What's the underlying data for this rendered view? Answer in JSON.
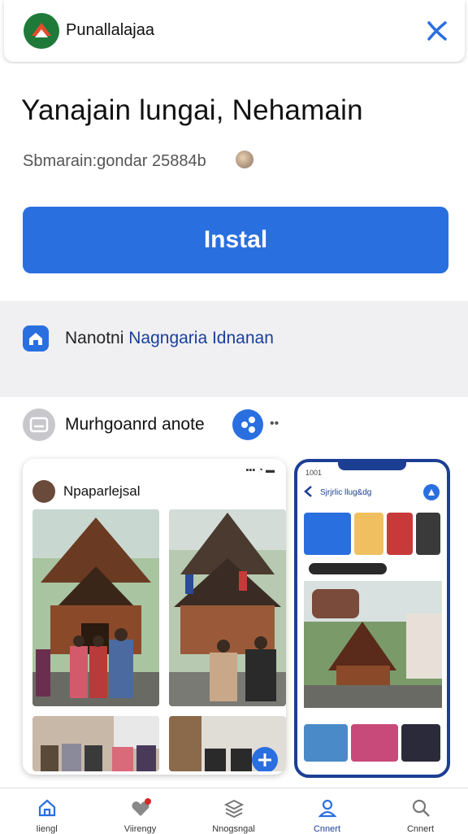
{
  "header": {
    "app_name": "Punallalajaa",
    "close_icon": "close-icon"
  },
  "hero": {
    "title": "Yanajain lungai, Nehamain",
    "subtitle": "Sbmarain:gondar 25884b",
    "install_label": "Instal"
  },
  "nav_row": {
    "text_bold": "Nanotni",
    "text_link": "Nagngaria Idnanan"
  },
  "section": {
    "label": "Murhgoanrd anote",
    "more": "••"
  },
  "card": {
    "title": "Npaparlejsal",
    "status": "▪▪▪ ◔ ▬"
  },
  "phone": {
    "status": "1001",
    "header": "Sjrjrlic llug&dg"
  },
  "tabs": [
    {
      "label": "Iiengl"
    },
    {
      "label": "Viirengy"
    },
    {
      "label": "Nnogsngal"
    },
    {
      "label": "Cnnert"
    }
  ],
  "colors": {
    "accent": "#2a6fe0",
    "dark_blue": "#1c3f93"
  }
}
